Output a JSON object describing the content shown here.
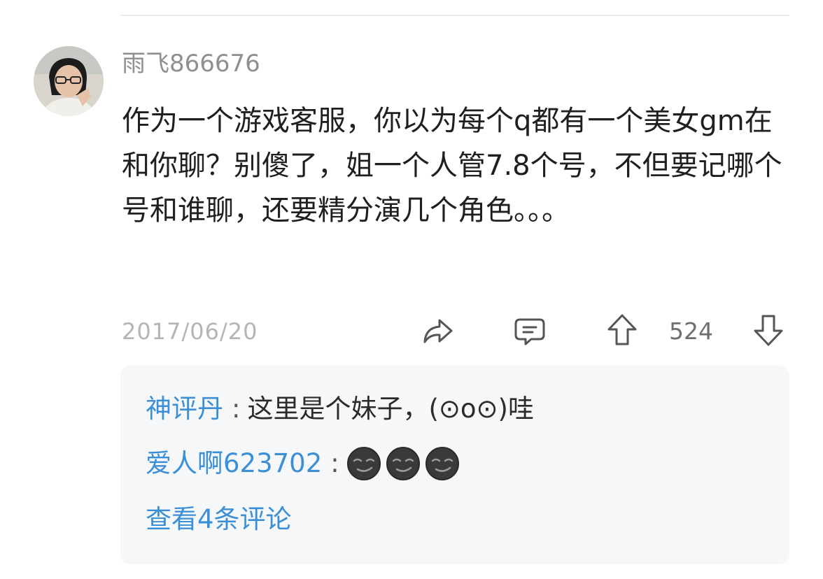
{
  "post": {
    "username": "雨飞866676",
    "content": "作为一个游戏客服，你以为每个q都有一个美女gm在和你聊？别傻了，姐一个人管7.8个号，不但要记哪个号和谁聊，还要精分演几个角色。。。",
    "date": "2017/06/20",
    "votes": "524"
  },
  "icons": {
    "share": "share-icon",
    "comment": "comment-icon",
    "upvote": "thumb-up-arrow-icon",
    "downvote": "thumb-down-arrow-icon",
    "emoji": "smirking-new-moon-emoji"
  },
  "replies": [
    {
      "name": "神评丹",
      "separator": ":",
      "text": "这里是个妹子，(⊙o⊙)哇"
    },
    {
      "name": "爱人啊623702",
      "separator": ":",
      "emoji_count": 3
    }
  ],
  "view_all_label": "查看4条评论",
  "colors": {
    "link_blue": "#3a8fd6",
    "username_gray": "#8f8f8f",
    "reply_background": "#f6f7f9"
  }
}
